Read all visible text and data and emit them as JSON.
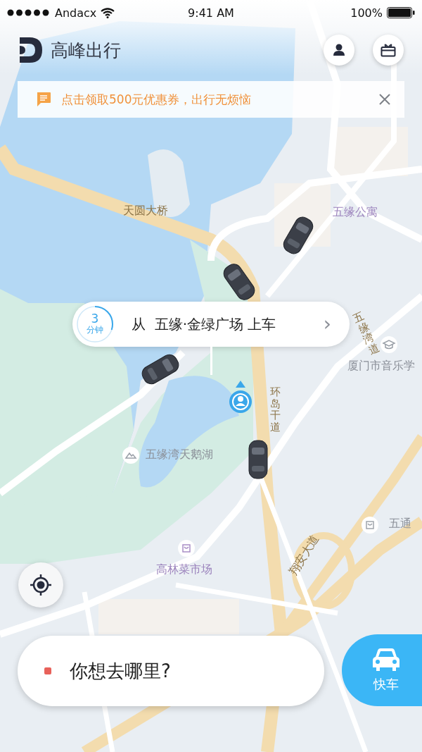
{
  "status_bar": {
    "carrier": "Andacx",
    "time": "9:41 AM",
    "battery": "100%"
  },
  "header": {
    "app_name": "高峰出行"
  },
  "banner": {
    "message": "点击领取500元优惠券，出行无烦恼"
  },
  "map": {
    "labels": [
      {
        "text": "天圆大桥",
        "kind": "road"
      },
      {
        "text": "五缘公寓",
        "kind": "place"
      },
      {
        "text": "五缘湾道",
        "kind": "road"
      },
      {
        "text": "厦门市音乐学",
        "kind": "poi"
      },
      {
        "text": "环岛干道",
        "kind": "road"
      },
      {
        "text": "五缘湾天鹅湖",
        "kind": "poi"
      },
      {
        "text": "高林菜市场",
        "kind": "place"
      },
      {
        "text": "五通",
        "kind": "poi"
      },
      {
        "text": "翔安大道",
        "kind": "road"
      }
    ]
  },
  "pickup": {
    "eta_value": "3",
    "eta_unit": "分钟",
    "level": 0.3,
    "text": "从  五缘·金绿广场 上车",
    "chevron": "›"
  },
  "search": {
    "placeholder": "你想去哪里?"
  },
  "ride_button": {
    "label": "快车"
  }
}
